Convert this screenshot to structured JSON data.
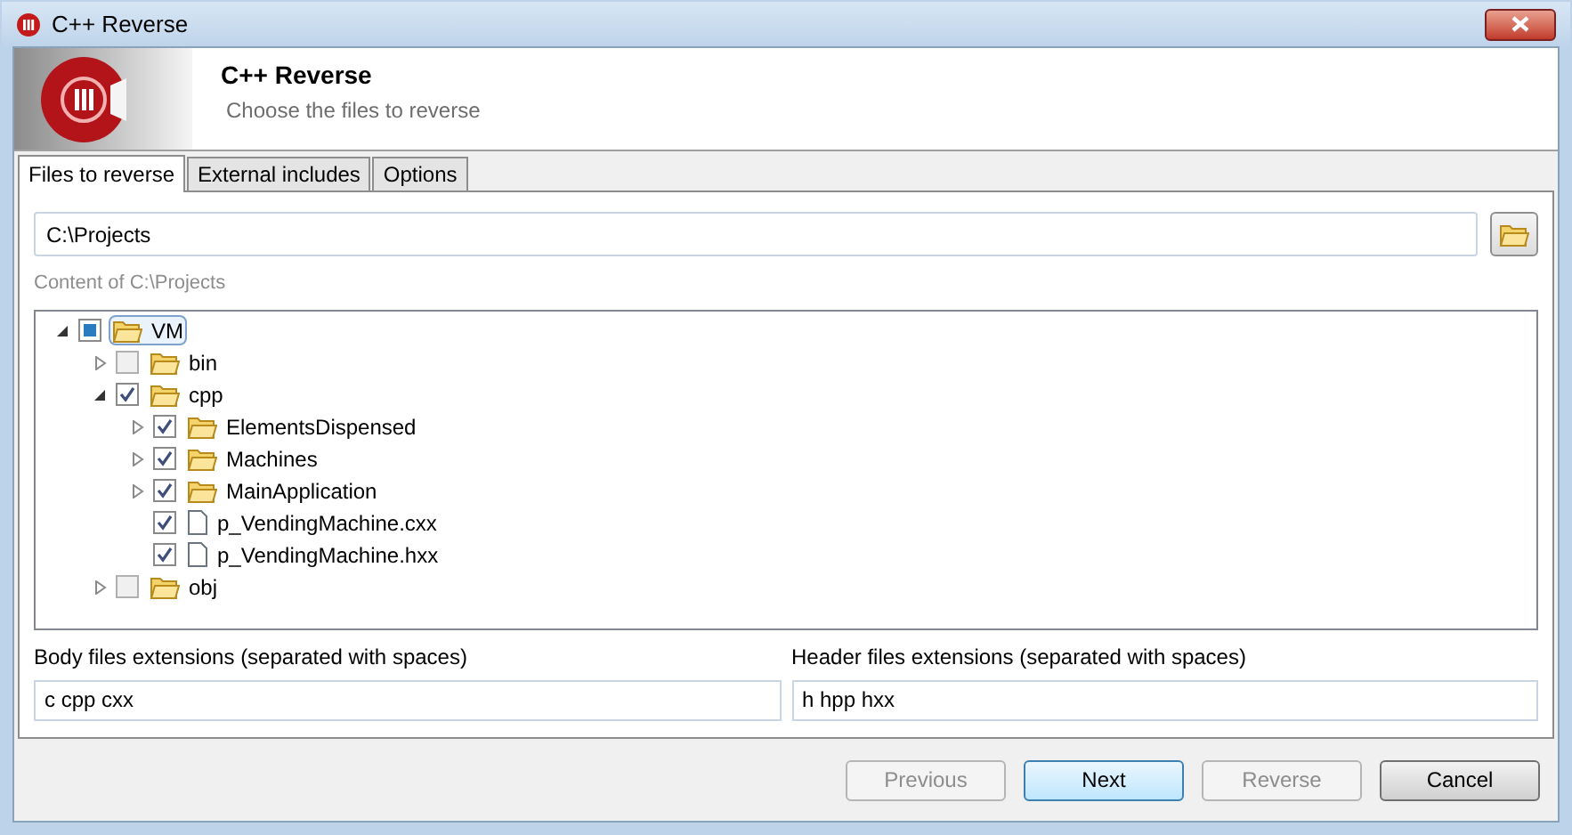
{
  "window": {
    "title": "C++ Reverse"
  },
  "header": {
    "title": "C++ Reverse",
    "subtitle": "Choose the files to reverse"
  },
  "tabs": [
    {
      "label": "Files to reverse",
      "selected": true
    },
    {
      "label": "External includes",
      "selected": false
    },
    {
      "label": "Options",
      "selected": false
    }
  ],
  "path_field": {
    "value": "C:\\Projects"
  },
  "content_label": "Content of C:\\Projects",
  "tree": [
    {
      "label": "VM",
      "kind": "folder",
      "checked": false,
      "indeterminate": true,
      "expanded": true,
      "selected": true,
      "children": [
        {
          "label": "bin",
          "kind": "folder",
          "checked": false,
          "indeterminate": false,
          "expanded": false,
          "selected": false
        },
        {
          "label": "cpp",
          "kind": "folder",
          "checked": true,
          "indeterminate": false,
          "expanded": true,
          "selected": false,
          "children": [
            {
              "label": "ElementsDispensed",
              "kind": "folder",
              "checked": true,
              "indeterminate": false,
              "expanded": false,
              "selected": false
            },
            {
              "label": "Machines",
              "kind": "folder",
              "checked": true,
              "indeterminate": false,
              "expanded": false,
              "selected": false
            },
            {
              "label": "MainApplication",
              "kind": "folder",
              "checked": true,
              "indeterminate": false,
              "expanded": false,
              "selected": false
            },
            {
              "label": "p_VendingMachine.cxx",
              "kind": "file",
              "checked": true,
              "indeterminate": false,
              "selected": false
            },
            {
              "label": "p_VendingMachine.hxx",
              "kind": "file",
              "checked": true,
              "indeterminate": false,
              "selected": false
            }
          ]
        },
        {
          "label": "obj",
          "kind": "folder",
          "checked": false,
          "indeterminate": false,
          "expanded": false,
          "selected": false
        }
      ]
    }
  ],
  "body_extensions": {
    "label": "Body files extensions (separated with spaces)",
    "value": "c cpp cxx"
  },
  "header_extensions": {
    "label": "Header files extensions (separated with spaces)",
    "value": "h hpp hxx"
  },
  "buttons": [
    {
      "label": "Previous",
      "disabled": true,
      "default": false
    },
    {
      "label": "Next",
      "disabled": false,
      "default": true
    },
    {
      "label": "Reverse",
      "disabled": true,
      "default": false
    },
    {
      "label": "Cancel",
      "disabled": false,
      "default": false
    }
  ]
}
